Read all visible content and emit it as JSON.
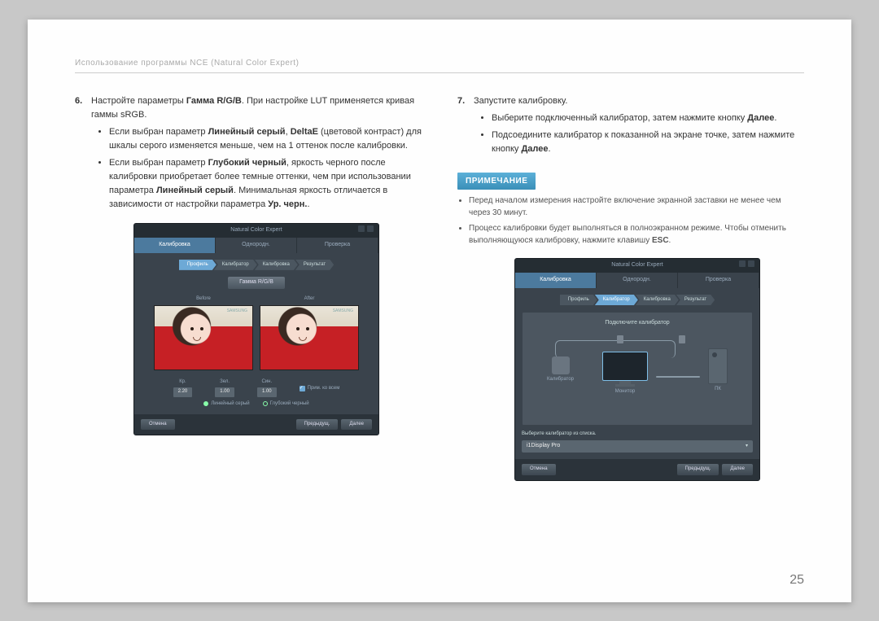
{
  "header": {
    "title": "Использование программы NCE (Natural Color Expert)"
  },
  "page_number": "25",
  "left": {
    "step_num": "6.",
    "step_text_a": "Настройте параметры ",
    "step_bold_a": "Гамма R/G/B",
    "step_text_b": ". При настройке LUT применяется кривая гаммы sRGB.",
    "b1_a": "Если выбран параметр ",
    "b1_bold1": "Линейный серый",
    "b1_b": ", ",
    "b1_bold2": "DeltaE",
    "b1_c": " (цветовой контраст) для шкалы серого изменяется меньше, чем на 1 оттенок после калибровки.",
    "b2_a": "Если выбран параметр ",
    "b2_bold1": "Глубокий черный",
    "b2_b": ", яркость черного после калибровки приобретает более темные оттенки, чем при использовании параметра ",
    "b2_bold2": "Линейный серый",
    "b2_c": ". Минимальная яркость отличается в зависимости от настройки параметра ",
    "b2_bold3": "Ур. черн.",
    "b2_d": "."
  },
  "right": {
    "step_num": "7.",
    "step_text": "Запустите калибровку.",
    "b1_a": "Выберите подключенный калибратор, затем нажмите кнопку ",
    "b1_bold": "Далее",
    "b1_b": ".",
    "b2_a": "Подсоедините калибратор к показанной на экране точке, затем нажмите кнопку ",
    "b2_bold": "Далее",
    "b2_b": ".",
    "note_label": "ПРИМЕЧАНИЕ",
    "note1": "Перед началом измерения настройте включение экранной заставки не менее чем через 30 минут.",
    "note2_a": "Процесс калибровки будет выполняться в полноэкранном режиме. Чтобы отменить выполняющуюся калибровку, нажмите клавишу ",
    "note2_bold": "ESC",
    "note2_b": "."
  },
  "ss1": {
    "app_title": "Natural Color Expert",
    "tabs": {
      "t1": "Калибровка",
      "t2": "Однородн.",
      "t3": "Проверка"
    },
    "bc": {
      "p1": "Профиль",
      "p2": "Калибратор",
      "p3": "Калибровка",
      "p4": "Результат"
    },
    "gamma_btn": "Гамма R/G/B",
    "before": "Before",
    "after": "After",
    "logo": "SAMSUNG",
    "sliders": {
      "r_label": "Кр.",
      "r_val": "2.20",
      "g_label": "Зел.",
      "g_val": "1.00",
      "b_label": "Син.",
      "b_val": "1.00"
    },
    "apply_all": "Прим. ко всем",
    "radio1": "Линейный серый",
    "radio2": "Глубокий черный",
    "btn_cancel": "Отмена",
    "btn_prev": "Предыдущ.",
    "btn_next": "Далее"
  },
  "ss2": {
    "app_title": "Natural Color Expert",
    "tabs": {
      "t1": "Калибровка",
      "t2": "Однородн.",
      "t3": "Проверка"
    },
    "bc": {
      "p1": "Профиль",
      "p2": "Калибратор",
      "p3": "Калибровка",
      "p4": "Результат"
    },
    "diag_title": "Подключите калибратор",
    "lbl_calib": "Калибратор",
    "lbl_monitor": "Монитор",
    "lbl_pc": "ПК",
    "select_label": "Выберите калибратор из списка.",
    "select_value": "i1Display Pro",
    "btn_cancel": "Отмена",
    "btn_prev": "Предыдущ.",
    "btn_next": "Далее"
  }
}
